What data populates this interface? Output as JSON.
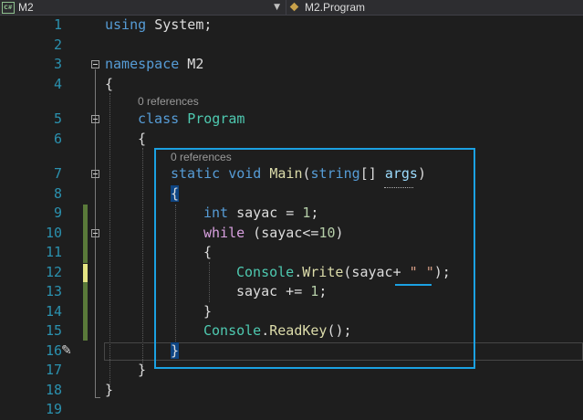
{
  "nav": {
    "project_icon": "csharp-project-icon",
    "project": "M2",
    "member_icon": "class-icon",
    "member": "M2.Program"
  },
  "editor": {
    "line_numbers": [
      "1",
      "2",
      "3",
      "4",
      "5",
      "6",
      "7",
      "8",
      "9",
      "10",
      "11",
      "12",
      "13",
      "14",
      "15",
      "16",
      "17",
      "18",
      "19"
    ],
    "codelens_class": "0 references",
    "codelens_main": "0 references",
    "lines": {
      "l1": [
        "using",
        " ",
        "System",
        ";"
      ],
      "l3": [
        "namespace",
        " M2"
      ],
      "l4": "{",
      "l5": [
        "class",
        " ",
        "Program"
      ],
      "l6": "{",
      "l7": [
        "static",
        " ",
        "void",
        " ",
        "Main",
        "(",
        "string",
        "[] ",
        "args",
        ")"
      ],
      "l8": "{",
      "l9": [
        "int",
        " sayac = ",
        "1",
        ";"
      ],
      "l10": [
        "while",
        " (sayac<=",
        "10",
        ")"
      ],
      "l11": "{",
      "l12": [
        "Console",
        ".",
        "Write",
        "(sayac+ ",
        "\" \"",
        ");"
      ],
      "l13": [
        "sayac += ",
        "1",
        ";"
      ],
      "l14": "}",
      "l15": [
        "Console",
        ".",
        "ReadKey",
        "();"
      ],
      "l16": "}",
      "l17": "}",
      "l18": "}"
    },
    "pencil_icon": "quick-actions-pencil-icon"
  }
}
